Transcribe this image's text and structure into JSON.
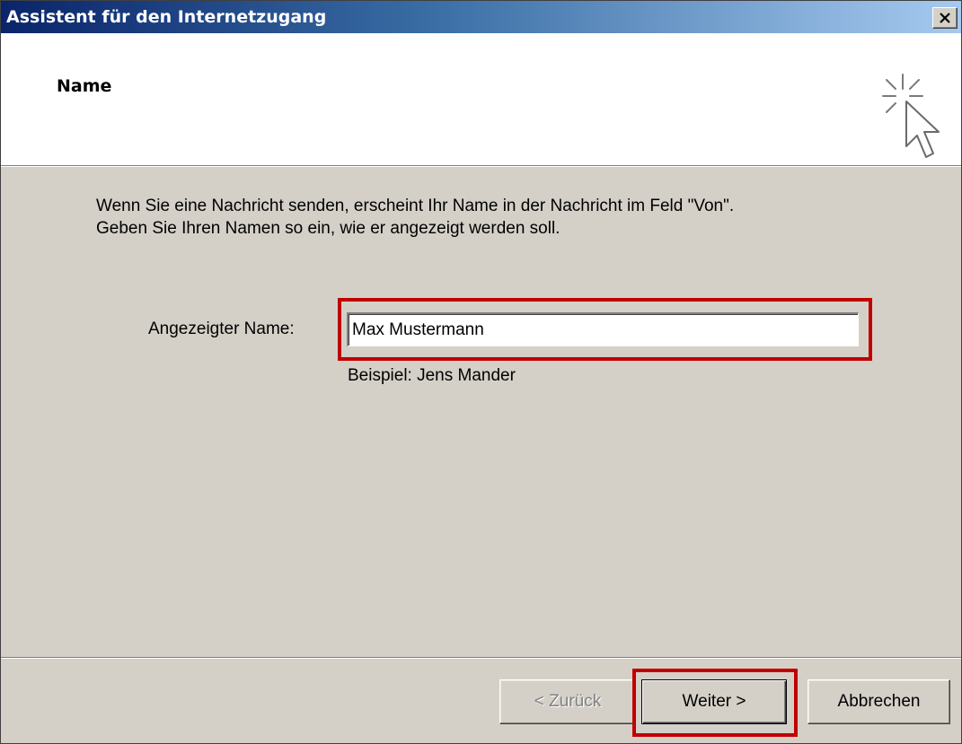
{
  "window": {
    "title": "Assistent für den Internetzugang"
  },
  "header": {
    "title": "Name",
    "icon": "cursor-sparkle-icon"
  },
  "content": {
    "intro_line1": "Wenn Sie eine Nachricht senden, erscheint Ihr Name in der Nachricht im Feld \"Von\".",
    "intro_line2": "Geben Sie Ihren Namen so ein, wie er angezeigt werden soll.",
    "field_label": "Angezeigter Name:",
    "field_value": "Max Mustermann",
    "example": "Beispiel: Jens Mander"
  },
  "buttons": {
    "back": "< Zurück",
    "next": "Weiter >",
    "cancel": "Abbrechen"
  },
  "colors": {
    "highlight": "#c00000",
    "dialog_bg": "#d4d0c8",
    "title_start": "#0a246a",
    "title_end": "#a6caf0"
  }
}
